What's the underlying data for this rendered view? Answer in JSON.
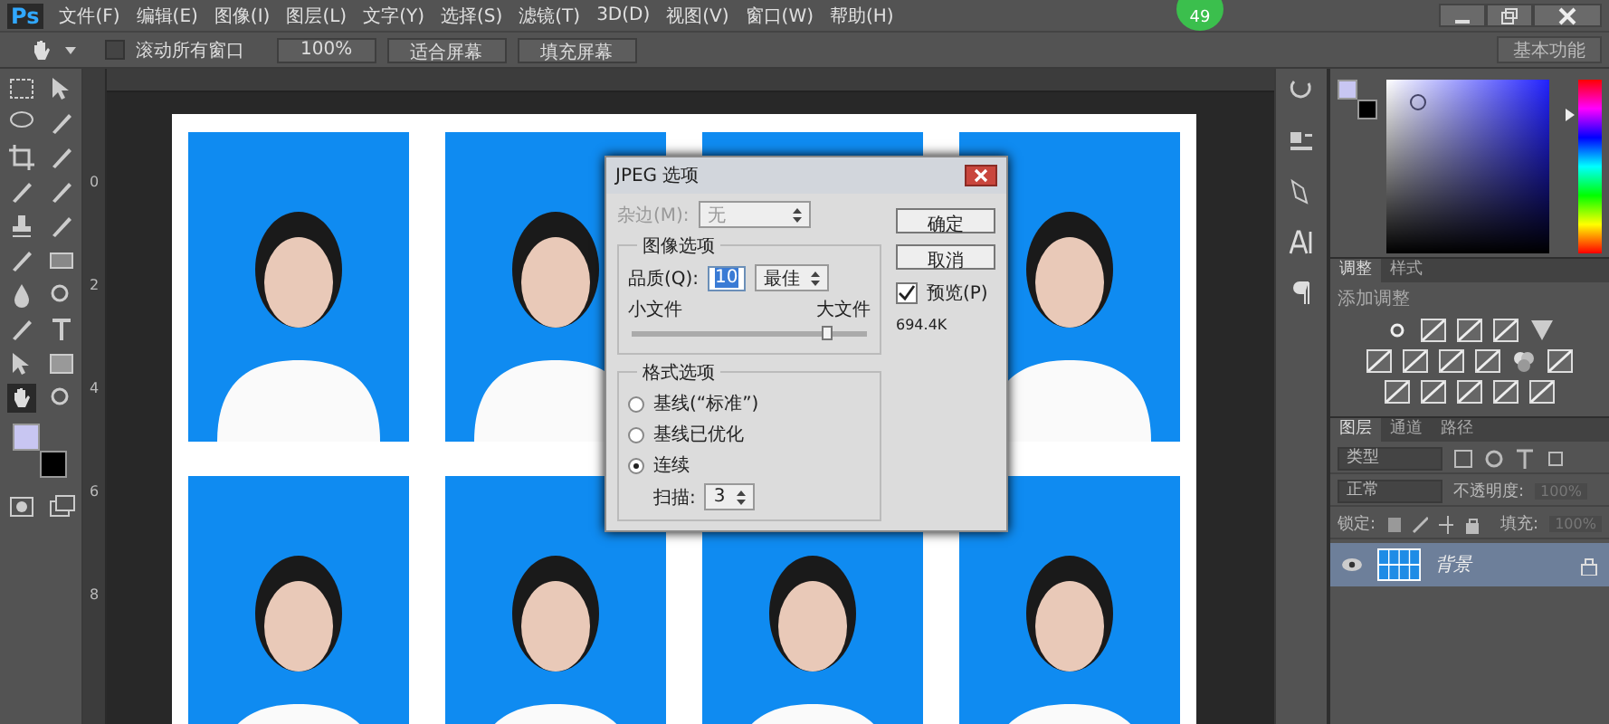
{
  "menu_bar": {
    "logo": "Ps",
    "items": [
      "文件(F)",
      "编辑(E)",
      "图像(I)",
      "图层(L)",
      "文字(Y)",
      "选择(S)",
      "滤镜(T)",
      "3D(D)",
      "视图(V)",
      "窗口(W)",
      "帮助(H)"
    ],
    "badge": "49"
  },
  "options_bar": {
    "scroll_all": {
      "label": "滚动所有窗口",
      "checked": false
    },
    "buttons": [
      "100%",
      "适合屏幕",
      "填充屏幕"
    ],
    "workspace": "基本功能"
  },
  "ruler": {
    "labels": [
      "0",
      "2",
      "4",
      "6",
      "8"
    ]
  },
  "dialog": {
    "title": "JPEG 选项",
    "matte": {
      "label": "杂边(M):",
      "value": "无",
      "disabled": true
    },
    "image_options": {
      "title": "图像选项",
      "quality_label": "品质(Q):",
      "quality_value": "10",
      "quality_preset": "最佳",
      "small_label": "小文件",
      "large_label": "大文件",
      "level": 0.83
    },
    "format_options": {
      "title": "格式选项",
      "options": [
        {
          "label": "基线(“标准”)",
          "selected": false
        },
        {
          "label": "基线已优化",
          "selected": false
        },
        {
          "label": "连续",
          "selected": true
        }
      ],
      "scans_label": "扫描:",
      "scans_value": "3"
    },
    "buttons": [
      "确定",
      "取消"
    ],
    "preview": {
      "label": "预览(P)",
      "checked": true
    },
    "file_size": "694.4K"
  },
  "color_panel": {
    "hue_slider": {
      "level": 0.8
    }
  },
  "adjustments": {
    "tabs": [
      {
        "label": "调整",
        "selected": true
      },
      {
        "label": "样式",
        "selected": false
      }
    ],
    "title": "添加调整"
  },
  "layers": {
    "tabs": [
      {
        "label": "图层",
        "selected": true
      },
      {
        "label": "通道",
        "selected": false
      },
      {
        "label": "路径",
        "selected": false
      }
    ],
    "filter": "类型",
    "blend_mode": "正常",
    "opacity_label": "不透明度:",
    "opacity_value": "100%",
    "lock_label": "锁定:",
    "fill_label": "填充:",
    "fill_value": "100%",
    "items": [
      {
        "name": "背景",
        "selected": true,
        "visible": true,
        "locked": true
      }
    ]
  }
}
